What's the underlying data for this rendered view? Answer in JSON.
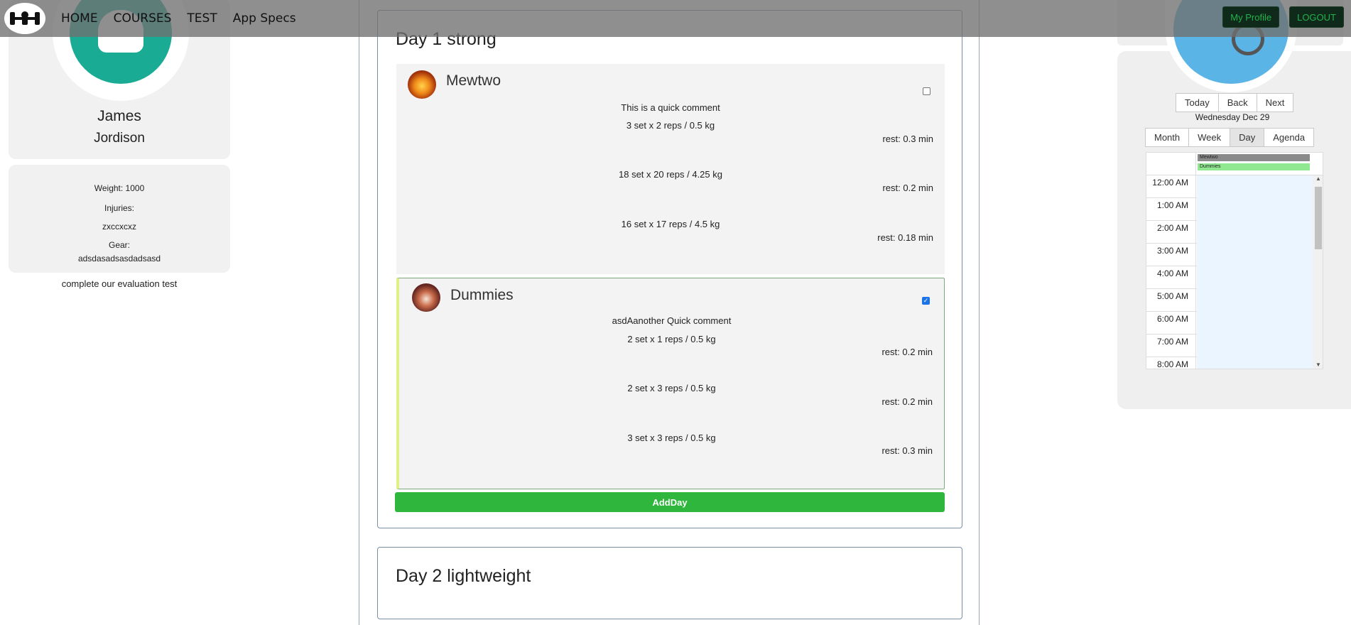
{
  "nav": {
    "links": [
      "HOME",
      "COURSES",
      "TEST",
      "App Specs"
    ],
    "my_profile": "My Profile",
    "logout": "LOGOUT"
  },
  "profile": {
    "first_name": "James",
    "last_name": "Jordison",
    "weight": "Weight: 1000",
    "injuries_label": "Injuries:",
    "injuries_value": "zxccxcxz",
    "gear_label": "Gear:",
    "gear_value": "adsdasadsasdadsasd",
    "evaluation_link": "complete our evaluation test"
  },
  "days": [
    {
      "title": "Day 1 strong",
      "exercises": [
        {
          "name": "Mewtwo",
          "comment": "This is a quick comment",
          "checked": false,
          "sets": [
            {
              "text": "3 set x 2 reps / 0.5 kg",
              "rest": "rest: 0.3 min"
            },
            {
              "text": "18 set x 20 reps / 4.25 kg",
              "rest": "rest: 0.2 min"
            },
            {
              "text": "16 set x 17 reps / 4.5 kg",
              "rest": "rest: 0.18 min"
            }
          ]
        },
        {
          "name": "Dummies",
          "comment": "asdAanother Quick comment",
          "checked": true,
          "sets": [
            {
              "text": "2 set x 1 reps / 0.5 kg",
              "rest": "rest: 0.2 min"
            },
            {
              "text": "2 set x 3 reps / 0.5 kg",
              "rest": "rest: 0.2 min"
            },
            {
              "text": "3 set x 3 reps / 0.5 kg",
              "rest": "rest: 0.3 min"
            }
          ]
        }
      ],
      "add_button": "AddDay"
    },
    {
      "title": "Day 2 lightweight"
    }
  ],
  "calendar": {
    "nav_buttons": [
      "Today",
      "Back",
      "Next"
    ],
    "date_label": "Wednesday Dec 29",
    "view_buttons": [
      "Month",
      "Week",
      "Day",
      "Agenda"
    ],
    "active_view": "Day",
    "all_day_events": [
      "Mewtwo",
      "Dummies"
    ],
    "event_colors": [
      "#8a8a8a",
      "#90e890"
    ],
    "time_slots": [
      "12:00 AM",
      "1:00 AM",
      "2:00 AM",
      "3:00 AM",
      "4:00 AM",
      "5:00 AM",
      "6:00 AM",
      "7:00 AM",
      "8:00 AM"
    ]
  },
  "colors": {
    "accent_green": "#2fb63c",
    "profile_avatar": "#1aab95",
    "calendar_avatar": "#5ab4e5"
  }
}
